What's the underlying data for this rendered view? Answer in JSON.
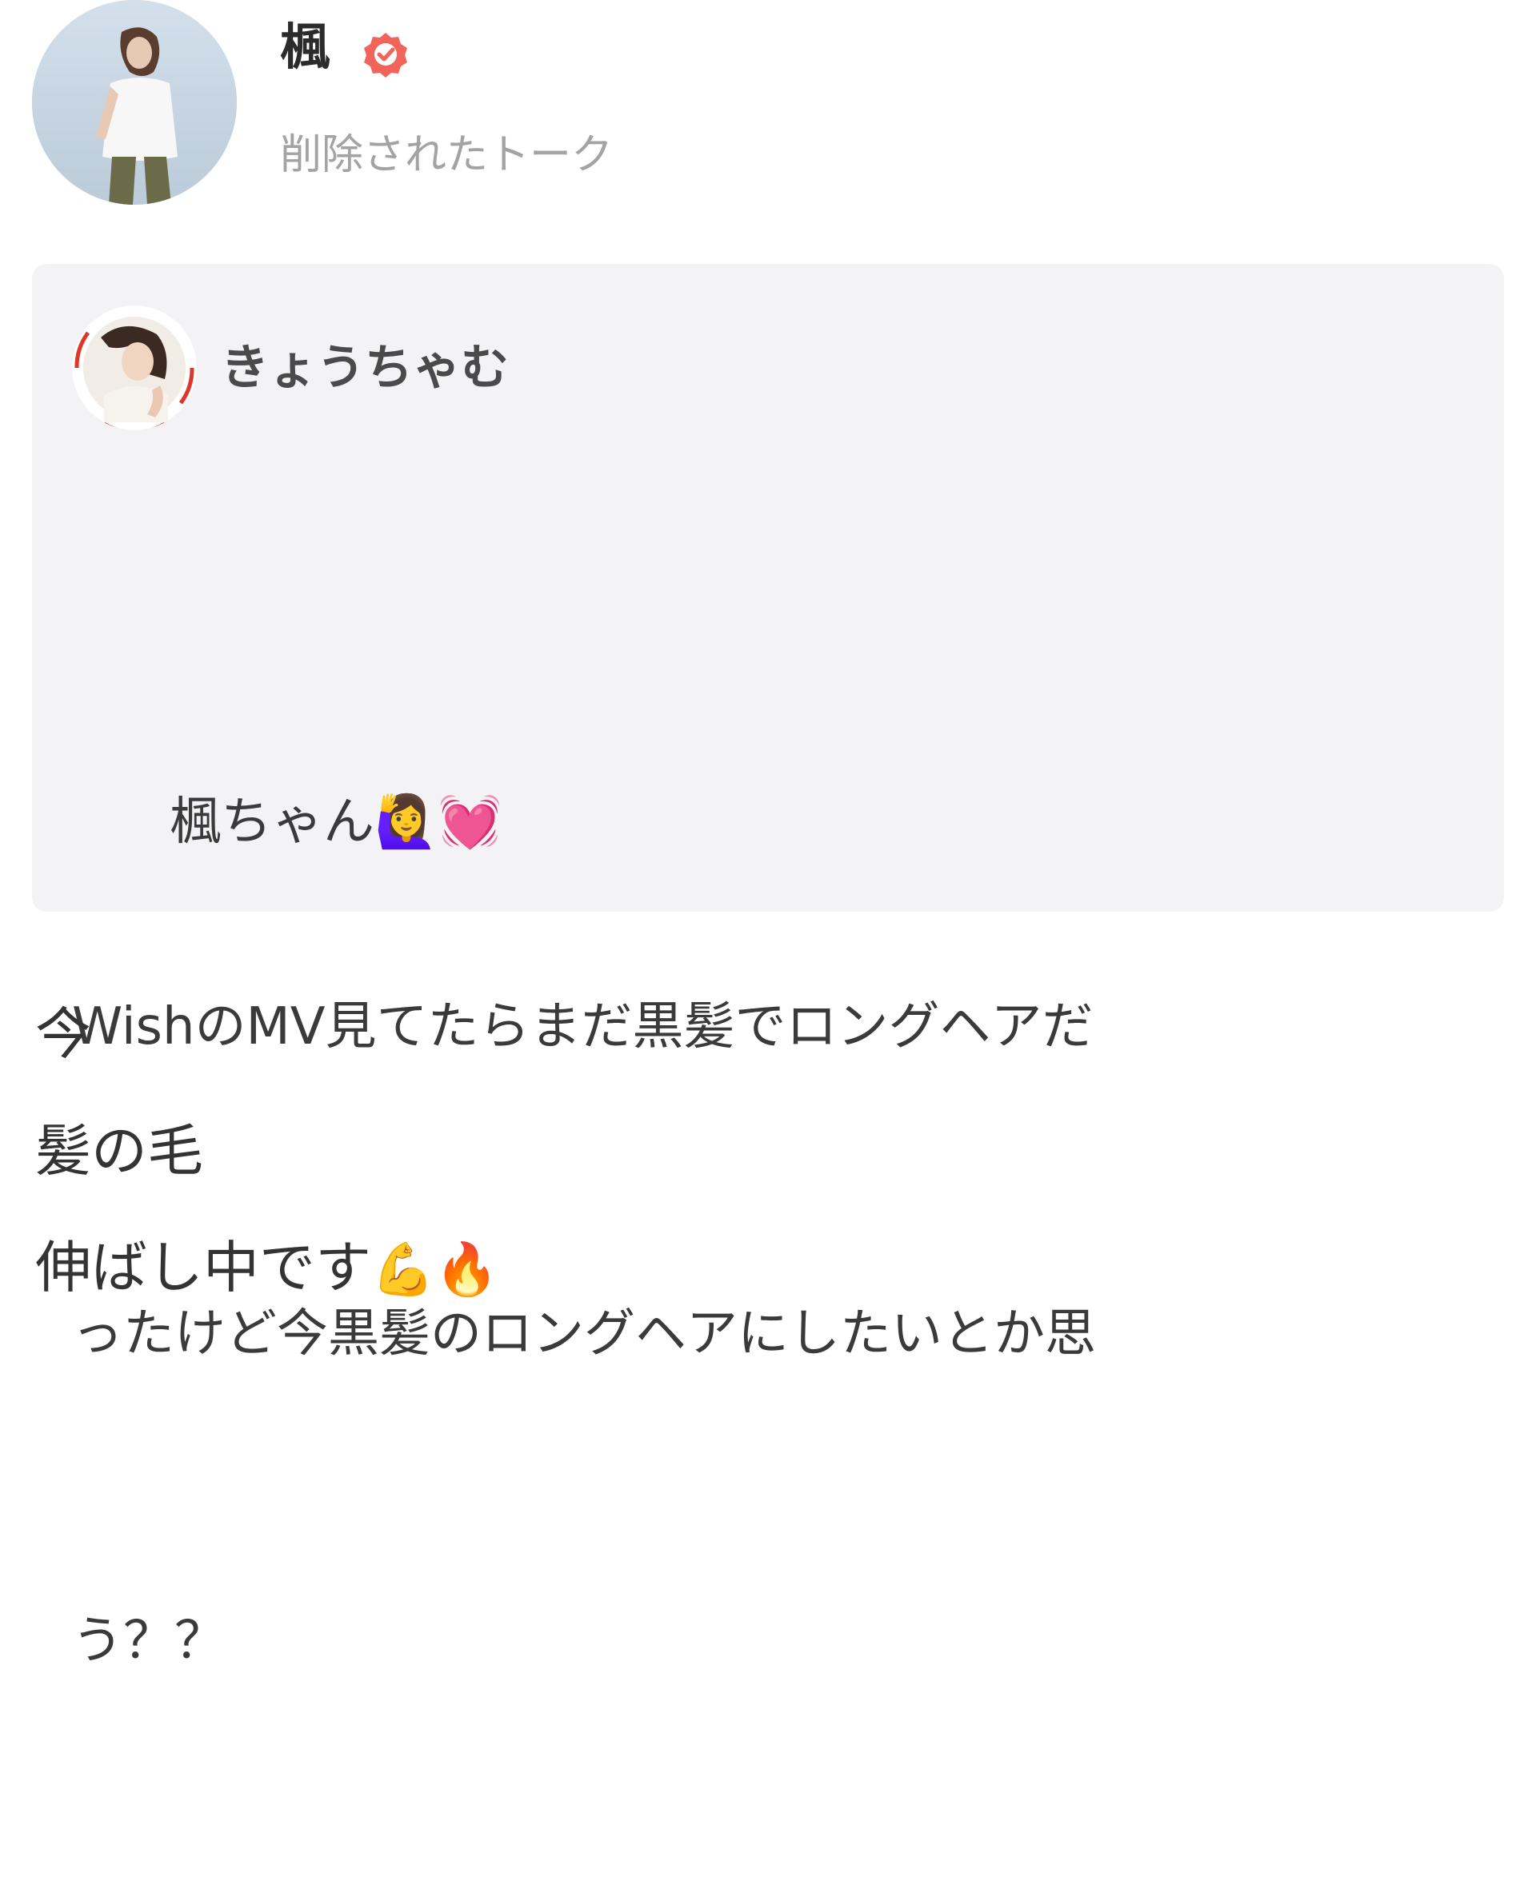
{
  "post": {
    "author": {
      "name": "楓",
      "verified": true,
      "verified_color": "#f0645a",
      "subtitle": "削除されたトーク"
    },
    "quoted_message": {
      "author_name": "きょうちゃむ",
      "avatar_ring_color": "#e0352b",
      "lines": [
        {
          "text": "楓ちゃん",
          "emojis": [
            "🙋‍♀️",
            "💓"
          ]
        },
        {
          "text": "WishのMV見てたらまだ黒髪でロングヘアだ",
          "emojis": []
        },
        {
          "text": "ったけど今黒髪のロングヘアにしたいとか思",
          "emojis": []
        },
        {
          "text": "う？？",
          "emojis": []
        }
      ]
    },
    "reply": {
      "lines": [
        {
          "text": "今",
          "emojis": []
        },
        {
          "text": "髪の毛",
          "emojis": []
        },
        {
          "text": "伸ばし中です",
          "emojis": [
            "💪",
            "🔥"
          ]
        }
      ]
    }
  },
  "colors": {
    "card_background": "#f3f3f5",
    "subtitle_text": "#a3a3a3",
    "body_text": "#333333"
  }
}
